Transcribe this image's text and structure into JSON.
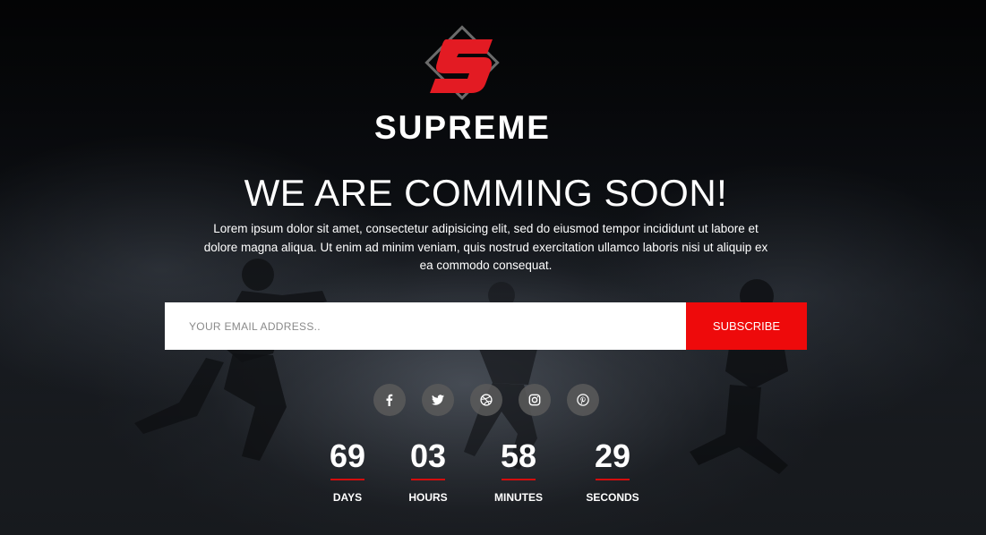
{
  "brand": {
    "name": "SUPREME",
    "logo_icon": "supreme-s-diamond-logo",
    "accent": "#e31b23"
  },
  "headline": "WE ARE COMMING SOON!",
  "description": "Lorem ipsum dolor sit amet, consectetur adipisicing elit, sed do eiusmod tempor incididunt ut labore et dolore magna aliqua. Ut enim ad minim veniam, quis nostrud exercitation ullamco laboris nisi ut aliquip ex ea commodo consequat.",
  "subscribe_form": {
    "email_placeholder": "YOUR EMAIL ADDRESS..",
    "email_value": "",
    "button_label": "SUBSCRIBE",
    "button_color": "#ee0a0b"
  },
  "social_links": [
    {
      "icon": "facebook-icon"
    },
    {
      "icon": "twitter-icon"
    },
    {
      "icon": "dribbble-icon"
    },
    {
      "icon": "instagram-icon"
    },
    {
      "icon": "pinterest-icon"
    }
  ],
  "countdown": [
    {
      "value": "69",
      "label": "DAYS"
    },
    {
      "value": "03",
      "label": "HOURS"
    },
    {
      "value": "58",
      "label": "MINUTES"
    },
    {
      "value": "29",
      "label": "SECONDS"
    }
  ],
  "colors": {
    "background": "#0b0d10",
    "text": "#ffffff",
    "countdown_underline": "#d40d0d",
    "social_bg": "#5a5a5a"
  }
}
